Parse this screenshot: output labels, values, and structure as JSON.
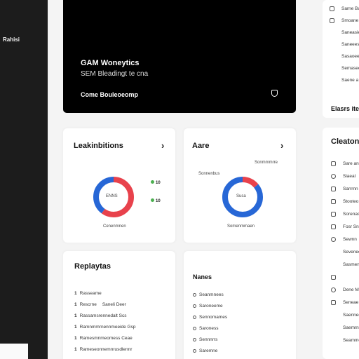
{
  "sidebar": {
    "brand": "Rahisi"
  },
  "hero": {
    "title": "GAM Woneytics",
    "subtitle": "SEM Bleadingt te cna",
    "link": "Come Bouleoeomp",
    "icon": "shield-icon"
  },
  "left_chart": {
    "title": "Leakinbitions",
    "center_label": "ENNS",
    "legend": [
      "10",
      "10"
    ],
    "caption": "Cenenmnen",
    "segments": [
      {
        "value": 60,
        "color": "#e8424c"
      },
      {
        "value": 40,
        "color": "#2767d6"
      }
    ]
  },
  "right_chart": {
    "title": "Aare",
    "top_left_label": "Sonnenbus",
    "top_right_label": "Sonmmmrre",
    "center_label": "Susa",
    "caption": "Somenmmaen",
    "segments": [
      {
        "value": 14,
        "color": "#e8424c"
      },
      {
        "value": 86,
        "color": "#2767d6"
      }
    ]
  },
  "replays": {
    "title": "Replaytas",
    "items": [
      {
        "num": "1",
        "text": "Rasseame",
        "extra": ""
      },
      {
        "num": "1",
        "text": "Rescrne",
        "extra": "Saneli Deer"
      },
      {
        "num": "1",
        "text": "Rassamsrennedalt Scs",
        "extra": ""
      },
      {
        "num": "1",
        "text": "Ramnmmrnennmeeide Gsp",
        "extra": ""
      },
      {
        "num": "1",
        "text": "Ramesmnmeomess Ceae",
        "extra": ""
      },
      {
        "num": "1",
        "text": "Rameseonnemnrusdlennr",
        "extra": ""
      }
    ]
  },
  "names": {
    "title": "Nanes",
    "items": [
      "Seanmnees",
      "Saroneeme",
      "Sennomames",
      "Saroness",
      "Sennnrrs",
      "Saremne"
    ]
  },
  "right_panel_1": {
    "items": [
      {
        "icon": "info-icon",
        "label": "Sarne Ba"
      },
      {
        "icon": "minus-icon",
        "label": "Smoane"
      },
      {
        "icon": "",
        "label": "Saneasie"
      },
      {
        "icon": "",
        "label": "Saneees"
      },
      {
        "icon": "",
        "label": "Sasaoee"
      },
      {
        "icon": "",
        "label": "Semasee"
      },
      {
        "icon": "",
        "label": "Saene a"
      }
    ],
    "footer": "Elasrs ite"
  },
  "right_panel_2": {
    "title": "Cleatonf",
    "items": [
      {
        "icon": "location-icon",
        "label": "Sare ane"
      },
      {
        "icon": "gear-icon",
        "label": "Siaeal"
      },
      {
        "icon": "list-icon",
        "label": "Sarrrnn"
      },
      {
        "icon": "grid-icon",
        "label": "Stooteo"
      },
      {
        "icon": "minus-icon",
        "label": "Sorenas"
      },
      {
        "icon": "box-icon",
        "label": "Fosr Sne"
      },
      {
        "icon": "circle-icon",
        "label": "Sewnn"
      },
      {
        "icon": "",
        "label": "Seveneee"
      },
      {
        "icon": "",
        "label": "Sasmenes"
      },
      {
        "icon": "pin-icon",
        "label": ""
      },
      {
        "icon": "gear-icon",
        "label": "Dene M"
      },
      {
        "icon": "cart-icon",
        "label": "Seneae"
      },
      {
        "icon": "",
        "label": "Saennee"
      },
      {
        "icon": "",
        "label": "Saemrnes"
      },
      {
        "icon": "",
        "label": "Seammeeea"
      }
    ]
  }
}
